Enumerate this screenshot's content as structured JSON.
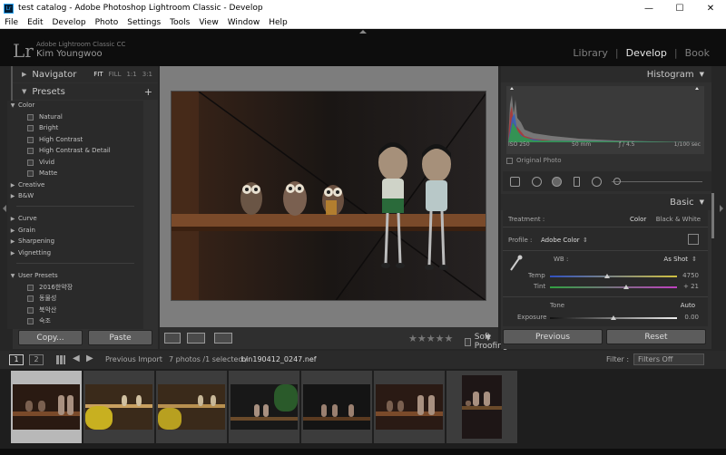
{
  "window": {
    "title": "test catalog - Adobe Photoshop Lightroom Classic - Develop",
    "app_icon_text": "Lr",
    "controls": [
      "—",
      "☐",
      "✕"
    ]
  },
  "menu": [
    "File",
    "Edit",
    "Develop",
    "Photo",
    "Settings",
    "Tools",
    "View",
    "Window",
    "Help"
  ],
  "identity": {
    "logo": "Lr",
    "product": "Adobe Lightroom Classic CC",
    "user": "Kim Youngwoo"
  },
  "modules": {
    "library": "Library",
    "develop": "Develop",
    "book": "Book",
    "sep": "|"
  },
  "navigator": {
    "title": "Navigator",
    "zooms": [
      "FIT",
      "FILL",
      "1:1",
      "3:1"
    ]
  },
  "presets": {
    "title": "Presets",
    "add": "+",
    "groups": {
      "color": {
        "label": "Color",
        "items": [
          "Natural",
          "Bright",
          "High Contrast",
          "High Contrast & Detail",
          "Vivid",
          "Matte"
        ]
      },
      "creative": "Creative",
      "bw": "B&W",
      "curve": "Curve",
      "grain": "Grain",
      "sharpening": "Sharpening",
      "vignetting": "Vignetting",
      "user": {
        "label": "User Presets",
        "items": [
          "2016한약장",
          "동물성",
          "북악산",
          "숙조"
        ]
      }
    }
  },
  "left_buttons": {
    "copy": "Copy...",
    "paste": "Paste"
  },
  "toolbar": {
    "stars": "★★★★★",
    "soft_proofing": "Soft Proofing",
    "menu_arrow": "▼"
  },
  "histogram": {
    "title": "Histogram",
    "iso": "ISO 250",
    "focal": "50 mm",
    "aperture": "ƒ / 4.5",
    "shutter": "1/100 sec",
    "original_photo": "Original Photo"
  },
  "basic": {
    "title": "Basic",
    "treatment_label": "Treatment :",
    "treatment_color": "Color",
    "treatment_bw": "Black & White",
    "profile_label": "Profile :",
    "profile_value": "Adobe Color",
    "profile_arrow": "⇕",
    "wb_label": "WB :",
    "wb_value": "As Shot",
    "temp_label": "Temp",
    "temp_value": "4750",
    "temp_level": 0.45,
    "tint_label": "Tint",
    "tint_value": "+ 21",
    "tint_level": 0.6,
    "tone_label": "Tone",
    "auto": "Auto",
    "exposure_label": "Exposure",
    "exposure_value": "0.00",
    "exposure_level": 0.5
  },
  "right_buttons": {
    "previous": "Previous",
    "reset": "Reset"
  },
  "filmbar": {
    "view1": "1",
    "view2": "2",
    "source": "Previous Import",
    "count": "7 photos /1 selected /",
    "filename": "bin190412_0247.nef",
    "filter_label": "Filter :",
    "filter_value": "Filters Off"
  },
  "colors": {
    "accent_active": "#e6e6e6",
    "panel_bg": "#303030",
    "selected_thumb": "#b8b8b8"
  }
}
